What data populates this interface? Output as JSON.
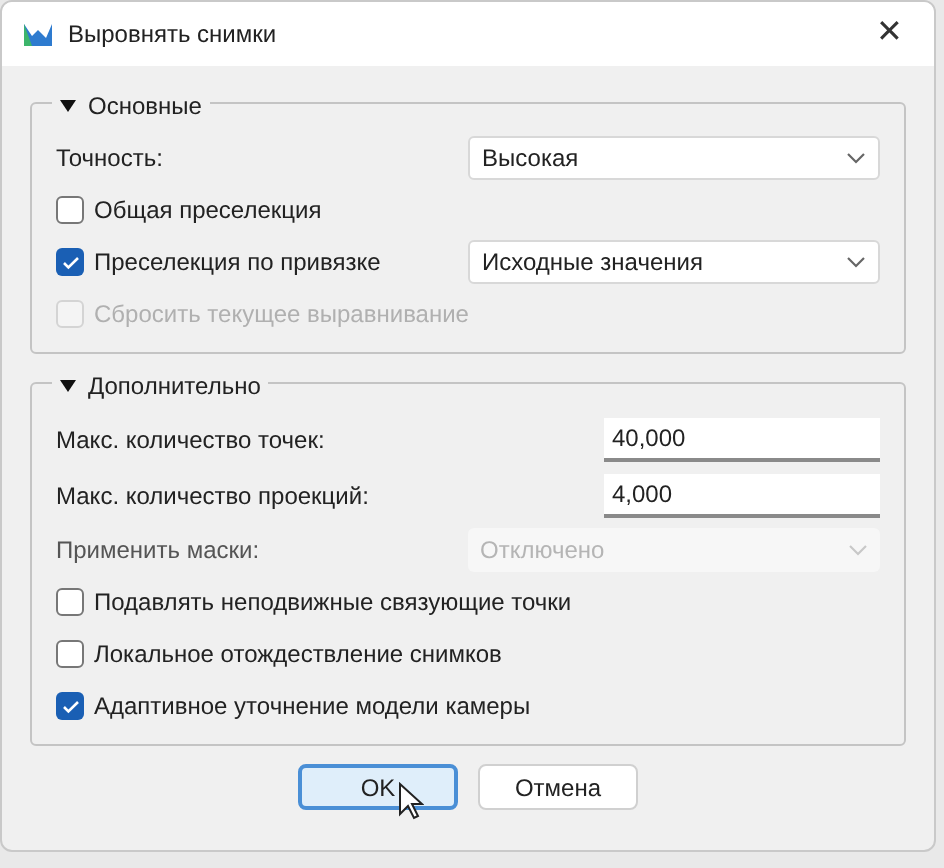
{
  "window": {
    "title": "Выровнять снимки",
    "close": "✕"
  },
  "sections": [
    {
      "title": "Основные",
      "expanded": true,
      "rows": [
        {
          "kind": "select",
          "label": "Точность:",
          "value": "Высокая",
          "disabled": false
        },
        {
          "kind": "checkbox",
          "label": "Общая преселекция",
          "checked": false,
          "disabled": false
        },
        {
          "kind": "checkbox_select",
          "label": "Преселекция по привязке",
          "checked": true,
          "disabled": false,
          "value": "Исходные значения"
        },
        {
          "kind": "checkbox",
          "label": "Сбросить текущее выравнивание",
          "checked": false,
          "disabled": true
        }
      ]
    },
    {
      "title": "Дополнительно",
      "expanded": true,
      "rows": [
        {
          "kind": "field",
          "label": "Макс. количество точек:",
          "value": "40,000"
        },
        {
          "kind": "field",
          "label": "Макс. количество проекций:",
          "value": "4,000"
        },
        {
          "kind": "select",
          "label": "Применить маски:",
          "value": "Отключено",
          "disabled": true
        },
        {
          "kind": "checkbox",
          "label": "Подавлять неподвижные связующие точки",
          "checked": false,
          "disabled": false
        },
        {
          "kind": "checkbox",
          "label": "Локальное отождествление снимков",
          "checked": false,
          "disabled": false
        },
        {
          "kind": "checkbox",
          "label": "Адаптивное уточнение модели камеры",
          "checked": true,
          "disabled": false
        }
      ]
    }
  ],
  "buttons": [
    {
      "label": "OK",
      "default": true
    },
    {
      "label": "Отмена",
      "default": false
    }
  ]
}
